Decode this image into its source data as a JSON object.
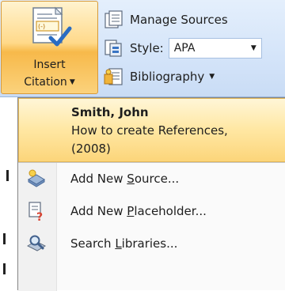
{
  "ribbon": {
    "insert_citation": {
      "line1": "Insert",
      "line2": "Citation",
      "icon": "insert-citation-icon"
    },
    "manage_sources": {
      "label": "Manage Sources",
      "icon": "manage-sources-icon"
    },
    "style": {
      "label": "Style:",
      "value": "APA",
      "icon": "style-icon"
    },
    "bibliography": {
      "label": "Bibliography",
      "icon": "bibliography-icon"
    }
  },
  "menu": {
    "citation": {
      "author": "Smith, John",
      "title": "How to create References,",
      "year": "(2008)"
    },
    "items": [
      {
        "pre": "Add New ",
        "key": "S",
        "post": "ource...",
        "icon": "add-source-icon"
      },
      {
        "pre": "Add New ",
        "key": "P",
        "post": "laceholder...",
        "icon": "add-placeholder-icon"
      },
      {
        "pre": "Search ",
        "key": "L",
        "post": "ibraries...",
        "icon": "search-libraries-icon"
      }
    ]
  },
  "colors": {
    "highlight": "#ffd98a",
    "ribbon_bg": "#d4e4f9",
    "menu_border": "#868686"
  }
}
